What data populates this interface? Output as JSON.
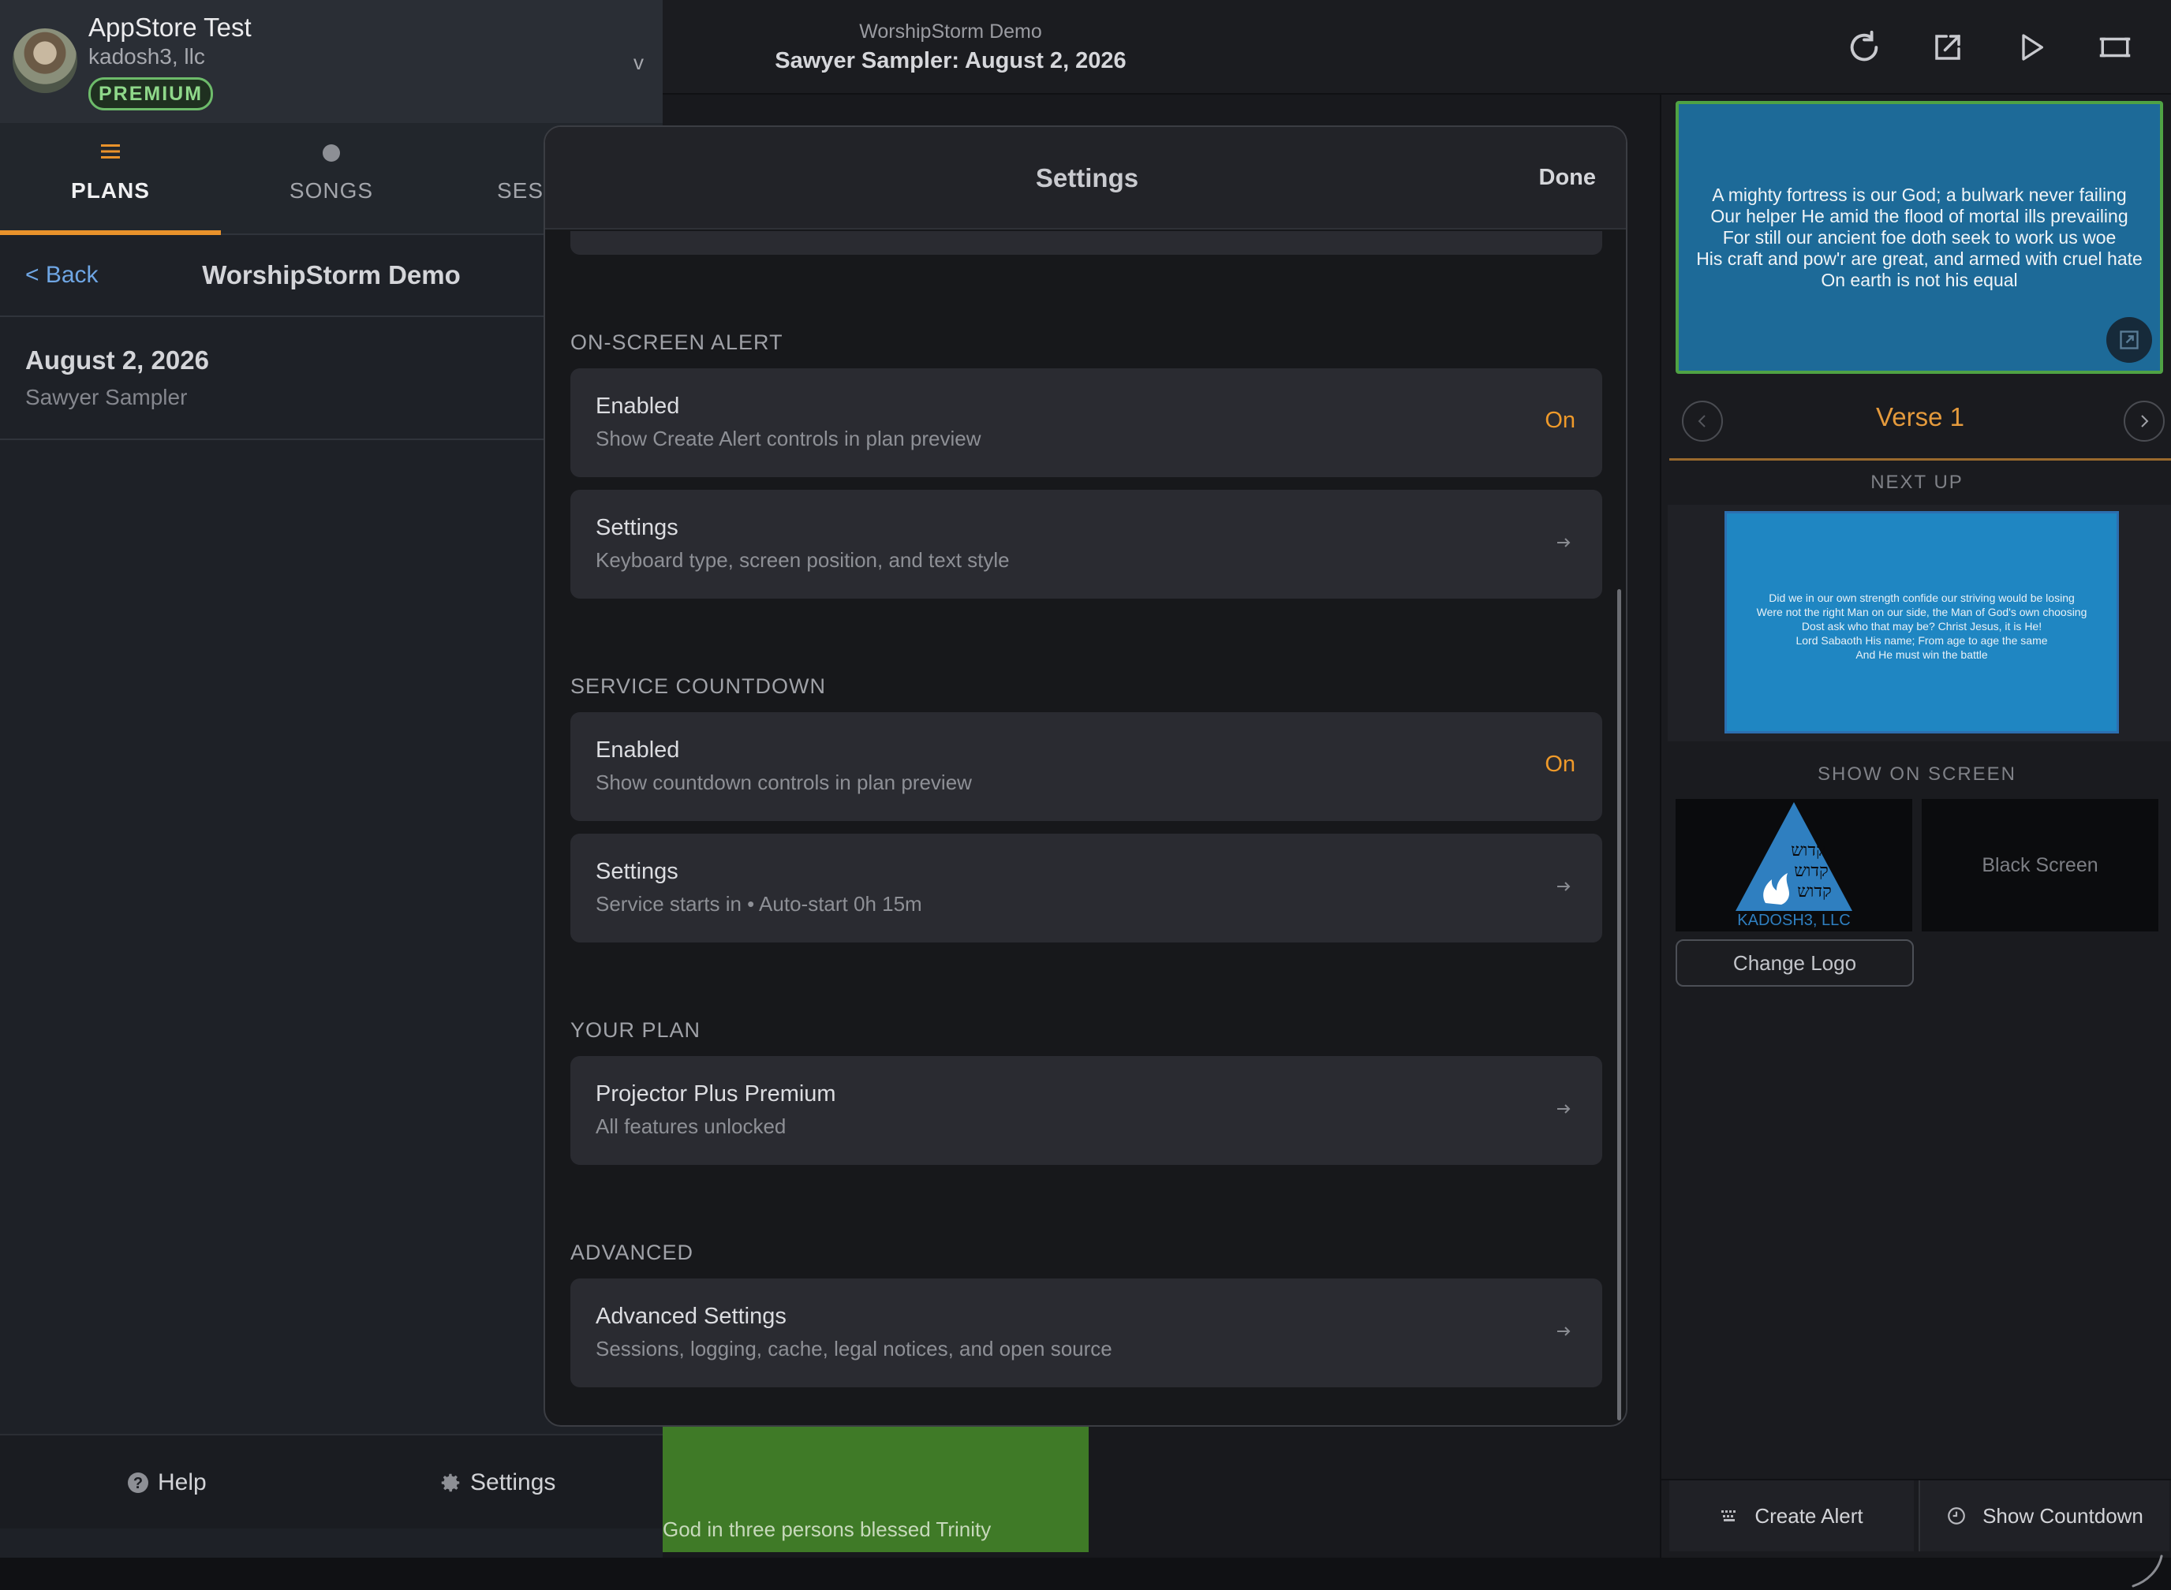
{
  "topbar": {
    "subtitle": "WorshipStorm Demo",
    "title": "Sawyer Sampler: August 2, 2026",
    "icons": [
      "refresh-icon",
      "export-icon",
      "play-icon",
      "projector-icon"
    ]
  },
  "profile": {
    "name": "AppStore Test",
    "org": "kadosh3, llc",
    "badge": "PREMIUM",
    "chevron": "v"
  },
  "tabs": [
    {
      "label": "PLANS",
      "icon": "menu-icon",
      "active": true
    },
    {
      "label": "SONGS",
      "icon": "dot-icon",
      "active": false
    },
    {
      "label": "SESS",
      "icon": "",
      "active": false
    }
  ],
  "nav": {
    "back": "< Back",
    "title": "WorshipStorm Demo"
  },
  "plan_item": {
    "date": "August 2, 2026",
    "name": "Sawyer Sampler"
  },
  "sidebar_footer": {
    "help": "Help",
    "settings": "Settings"
  },
  "background_card": {
    "text": "God in three persons blessed Trinity"
  },
  "right_panel": {
    "preview_lines": [
      "A mighty fortress is our God; a bulwark never failing",
      "Our helper He amid the flood of mortal ills prevailing",
      "For still our ancient foe doth seek to work us woe",
      "His craft and pow'r are great, and armed with cruel hate",
      "On earth is not his equal"
    ],
    "verse_label": "Verse 1",
    "next_up_label": "NEXT UP",
    "next_up_lines": [
      "Did we in our own strength confide our striving would be losing",
      "Were not the right Man on our side, the Man of God's own choosing",
      "Dost ask who that may be? Christ Jesus, it is He!",
      "Lord Sabaoth His name; From age to age the same",
      "And He must win the battle"
    ],
    "show_on_screen_label": "SHOW ON SCREEN",
    "logo_text": "KADOSH3, LLC",
    "logo_hebrew": [
      "קדוש",
      "קדוש",
      "קדוש"
    ],
    "black_screen": "Black Screen",
    "change_logo": "Change Logo",
    "create_alert": "Create Alert",
    "show_countdown": "Show Countdown"
  },
  "modal": {
    "title": "Settings",
    "done": "Done",
    "sections": {
      "alert": {
        "label": "ON-SCREEN ALERT",
        "enabled_title": "Enabled",
        "enabled_sub": "Show Create Alert controls in plan preview",
        "enabled_value": "On",
        "settings_title": "Settings",
        "settings_sub": "Keyboard type, screen position, and text style"
      },
      "countdown": {
        "label": "SERVICE COUNTDOWN",
        "enabled_title": "Enabled",
        "enabled_sub": "Show countdown controls in plan preview",
        "enabled_value": "On",
        "settings_title": "Settings",
        "settings_sub": "Service starts in • Auto-start 0h 15m"
      },
      "plan": {
        "label": "YOUR PLAN",
        "title": "Projector Plus Premium",
        "sub": "All features unlocked"
      },
      "advanced": {
        "label": "ADVANCED",
        "title": "Advanced Settings",
        "sub": "Sessions, logging, cache, legal notices, and open source"
      }
    }
  },
  "colors": {
    "accent": "#ef9a2a",
    "premium_green": "#6dbb6a",
    "preview_blue": "#1d6a98",
    "link_blue": "#6fa6e4"
  }
}
